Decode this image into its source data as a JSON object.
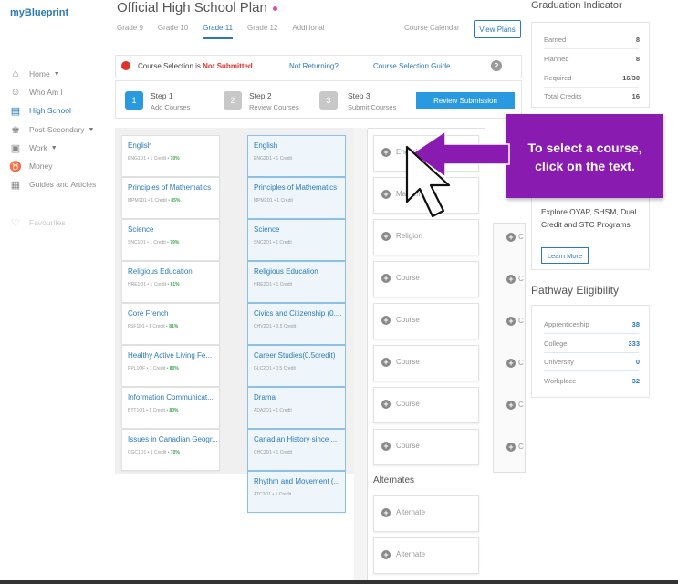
{
  "app": {
    "logo": "myBlueprint"
  },
  "sidebar": {
    "items": [
      {
        "label": "Home",
        "icon": "home-icon",
        "caret": true
      },
      {
        "label": "Who Am I",
        "icon": "person-icon",
        "caret": false
      },
      {
        "label": "High School",
        "icon": "school-icon",
        "caret": false,
        "active": true
      },
      {
        "label": "Post-Secondary",
        "icon": "graduation-cap-icon",
        "caret": true
      },
      {
        "label": "Work",
        "icon": "briefcase-icon",
        "caret": true
      },
      {
        "label": "Money",
        "icon": "piggy-bank-icon",
        "caret": false
      },
      {
        "label": "Guides and Articles",
        "icon": "document-icon",
        "caret": false
      }
    ],
    "favourites": {
      "label": "Favourites",
      "icon": "heart-icon"
    }
  },
  "header": {
    "title": "Official High School Plan",
    "tabs": [
      {
        "label": "Grade 9",
        "active": false
      },
      {
        "label": "Grade 10",
        "active": false
      },
      {
        "label": "Grade 11",
        "active": true
      },
      {
        "label": "Grade 12",
        "active": false
      },
      {
        "label": "Additional",
        "active": false
      }
    ],
    "course_calendar": "Course Calendar",
    "view_plans": "View Plans"
  },
  "status": {
    "prefix": "Course Selection is",
    "state": "Not Submitted",
    "not_returning": "Not Returning?",
    "guide": "Course Selection Guide",
    "info": "?"
  },
  "steps": [
    {
      "num": "1",
      "title": "Step 1",
      "sub": "Add Courses"
    },
    {
      "num": "2",
      "title": "Step 2",
      "sub": "Review Courses"
    },
    {
      "num": "3",
      "title": "Step 3",
      "sub": "Submit Courses"
    }
  ],
  "review_button": "Review Submission",
  "grade9_courses": [
    {
      "title": "English",
      "code": "ENG1D1 • 1 Credit •",
      "grade": "70%"
    },
    {
      "title": "Principles of Mathematics",
      "code": "MPM1D1 • 1 Credit •",
      "grade": "85%"
    },
    {
      "title": "Science",
      "code": "SNC1D1 • 1 Credit •",
      "grade": "79%"
    },
    {
      "title": "Religious Education",
      "code": "HRE1O1 • 1 Credit •",
      "grade": "81%"
    },
    {
      "title": "Core French",
      "code": "FSF1D1 • 1 Credit •",
      "grade": "81%"
    },
    {
      "title": "Healthy Active Living Fe...",
      "code": "PPL1OF • 1 Credit •",
      "grade": "80%"
    },
    {
      "title": "Information Communicat...",
      "code": "BTT1O1 • 1 Credit •",
      "grade": "80%"
    },
    {
      "title": "Issues in Canadian Geogr...",
      "code": "CGC1D1 • 1 Credit •",
      "grade": "70%"
    }
  ],
  "grade10_courses": [
    {
      "title": "English",
      "code": "ENG2D1 • 1 Credit"
    },
    {
      "title": "Principles of Mathematics",
      "code": "MPM2D1 • 1 Credit"
    },
    {
      "title": "Science",
      "code": "SNC2D1 • 1 Credit"
    },
    {
      "title": "Religious Education",
      "code": "HRE2O1 • 1 Credit"
    },
    {
      "title": "Civics and Citizenship (0....",
      "code": "CHV2O1 • 0.5 Credit"
    },
    {
      "title": "Career Studies(0.5credit)",
      "code": "GLC2O1 • 0.5 Credit"
    },
    {
      "title": "Drama",
      "code": "ADA2O1 • 1 Credit"
    },
    {
      "title": "Canadian History since ...",
      "code": "CHC2D1 • 1 Credit"
    },
    {
      "title": "Rhythm and Movement (...",
      "code": "ATC2O1 • 1 Credit"
    }
  ],
  "grade11_slots": [
    "English",
    "Mathematics",
    "Religion",
    "Course",
    "Course",
    "Course",
    "Course",
    "Course"
  ],
  "alternates": {
    "heading": "Alternates",
    "slots": [
      "Alternate",
      "Alternate"
    ]
  },
  "grade12_labels": [
    "C",
    "C",
    "C",
    "C",
    "C",
    "C"
  ],
  "graduation": {
    "title": "Graduation Indicator",
    "rows": [
      {
        "label": "Earned",
        "value": "8"
      },
      {
        "label": "Planned",
        "value": "8"
      },
      {
        "label": "Required",
        "value": "16/30"
      },
      {
        "label": "Total Credits",
        "value": "16"
      }
    ]
  },
  "explore": {
    "text": "Explore OYAP, SHSM, Dual Credit and STC Programs",
    "button": "Learn More"
  },
  "pathway": {
    "title": "Pathway Eligibility",
    "rows": [
      {
        "label": "Apprenticeship",
        "value": "38"
      },
      {
        "label": "College",
        "value": "333"
      },
      {
        "label": "University",
        "value": "0"
      },
      {
        "label": "Workplace",
        "value": "32"
      }
    ]
  },
  "callout": {
    "line1": "To select a course,",
    "line2": "click on the text."
  },
  "colors": {
    "accent": "#2a7ab8",
    "callout": "#8a1bb0",
    "error": "#e0312a",
    "grade_ok": "#3aa84a"
  }
}
